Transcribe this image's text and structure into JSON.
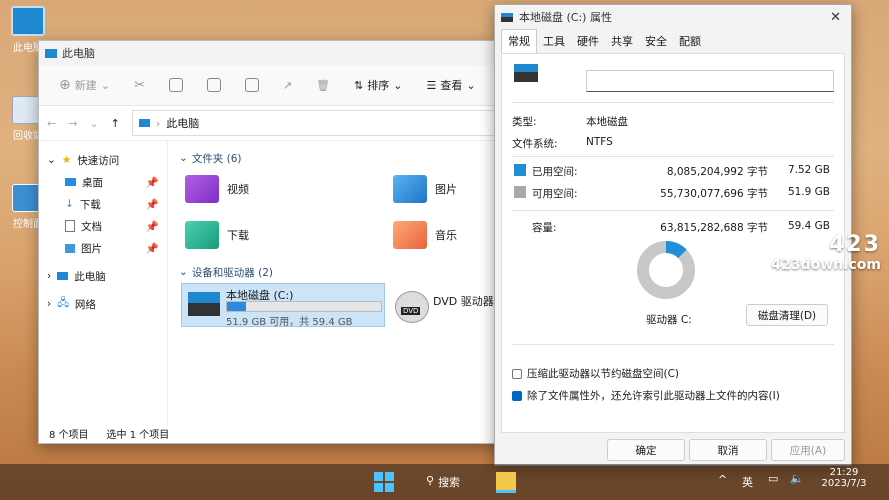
{
  "desktop": {
    "icons": [
      {
        "label": "此电脑"
      },
      {
        "label": "回收站"
      },
      {
        "label": "控制面"
      }
    ]
  },
  "explorer": {
    "title": "此电脑",
    "toolbar": {
      "new": "新建",
      "sort": "排序",
      "view": "查看"
    },
    "address": "此电脑",
    "nav": {
      "quick": "快速访问",
      "desktop": "桌面",
      "downloads": "下载",
      "documents": "文档",
      "pictures": "图片",
      "thispc": "此电脑",
      "network": "网络"
    },
    "folders_header": "文件夹 (6)",
    "folders": [
      "视频",
      "图片",
      "下载",
      "音乐"
    ],
    "drives_header": "设备和驱动器 (2)",
    "drive_c": {
      "name": "本地磁盘 (C:)",
      "space": "51.9 GB 可用，共 59.4 GB",
      "used_fraction": 0.126
    },
    "dvd": {
      "name": "DVD 驱动器 (",
      "icon_label": "DVD"
    },
    "status": {
      "count": "8 个项目",
      "selected": "选中 1 个项目"
    }
  },
  "props": {
    "title": "本地磁盘 (C:) 属性",
    "tabs": [
      "常规",
      "工具",
      "硬件",
      "共享",
      "安全",
      "配额"
    ],
    "name_value": "",
    "type_label": "类型:",
    "type_value": "本地磁盘",
    "fs_label": "文件系统:",
    "fs_value": "NTFS",
    "used_label": "已用空间:",
    "used_bytes": "8,085,204,992 字节",
    "used_gb": "7.52 GB",
    "free_label": "可用空间:",
    "free_bytes": "55,730,077,696 字节",
    "free_gb": "51.9 GB",
    "cap_label": "容量:",
    "cap_bytes": "63,815,282,688 字节",
    "cap_gb": "59.4 GB",
    "drive_label": "驱动器 C:",
    "cleanup": "磁盘清理(D)",
    "compress": "压缩此驱动器以节约磁盘空间(C)",
    "index": "除了文件属性外，还允许索引此驱动器上文件的内容(I)",
    "ok": "确定",
    "cancel": "取消",
    "apply": "应用(A)",
    "colors": {
      "used": "#1f8fd6",
      "free": "#a9a9a9"
    }
  },
  "taskbar": {
    "search": "搜索",
    "lang": "英",
    "time": "21:29",
    "date": "2023/7/3"
  },
  "watermark": {
    "logo": "423",
    "site": "423down.com"
  }
}
